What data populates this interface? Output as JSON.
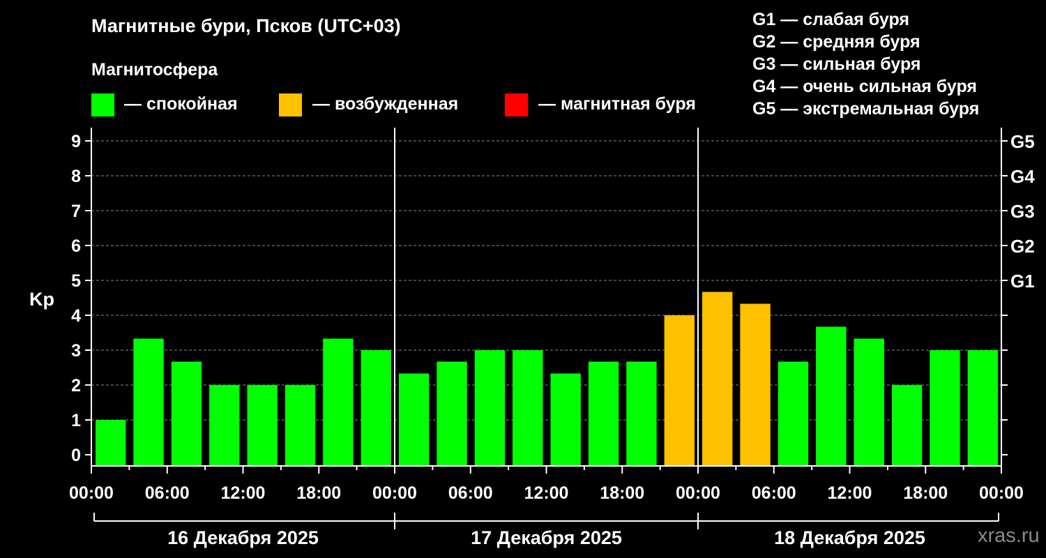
{
  "title": "Магнитные бури, Псков (UTC+03)",
  "legend": {
    "heading": "Магнитосфера",
    "items": [
      {
        "label": "— спокойная",
        "color": "#00ff00"
      },
      {
        "label": "— возбужденная",
        "color": "#ffc000"
      },
      {
        "label": "— магнитная буря",
        "color": "#ff0000"
      }
    ]
  },
  "g_legend": [
    "G1 — слабая буря",
    "G2 — средняя буря",
    "G3 — сильная буря",
    "G4 — очень сильная буря",
    "G5 — экстремальная буря"
  ],
  "watermark": "xras.ru",
  "chart_data": {
    "type": "bar",
    "ylabel": "Kp",
    "ylim": [
      0,
      9
    ],
    "y_ticks": [
      "0",
      "1",
      "2",
      "3",
      "4",
      "5",
      "6",
      "7",
      "8",
      "9"
    ],
    "right_axis_labels": [
      {
        "value": 5,
        "label": "G1"
      },
      {
        "value": 6,
        "label": "G2"
      },
      {
        "value": 7,
        "label": "G3"
      },
      {
        "value": 8,
        "label": "G4"
      },
      {
        "value": 9,
        "label": "G5"
      }
    ],
    "x_tick_labels": [
      "00:00",
      "06:00",
      "12:00",
      "18:00",
      "00:00",
      "06:00",
      "12:00",
      "18:00",
      "00:00",
      "06:00",
      "12:00",
      "18:00",
      "00:00"
    ],
    "days": [
      "16 Декабря 2025",
      "17 Декабря 2025",
      "18 Декабря 2025"
    ],
    "grid": true,
    "values": [
      1.0,
      3.33,
      2.67,
      2.0,
      2.0,
      2.0,
      3.33,
      3.0,
      2.33,
      2.67,
      3.0,
      3.0,
      2.33,
      2.67,
      2.67,
      4.0,
      4.67,
      4.33,
      2.67,
      3.67,
      3.33,
      2.0,
      3.0,
      3.0
    ],
    "bar_colors": [
      "#00ff00",
      "#00ff00",
      "#00ff00",
      "#00ff00",
      "#00ff00",
      "#00ff00",
      "#00ff00",
      "#00ff00",
      "#00ff00",
      "#00ff00",
      "#00ff00",
      "#00ff00",
      "#00ff00",
      "#00ff00",
      "#00ff00",
      "#ffc000",
      "#ffc000",
      "#ffc000",
      "#00ff00",
      "#00ff00",
      "#00ff00",
      "#00ff00",
      "#00ff00",
      "#00ff00"
    ]
  }
}
